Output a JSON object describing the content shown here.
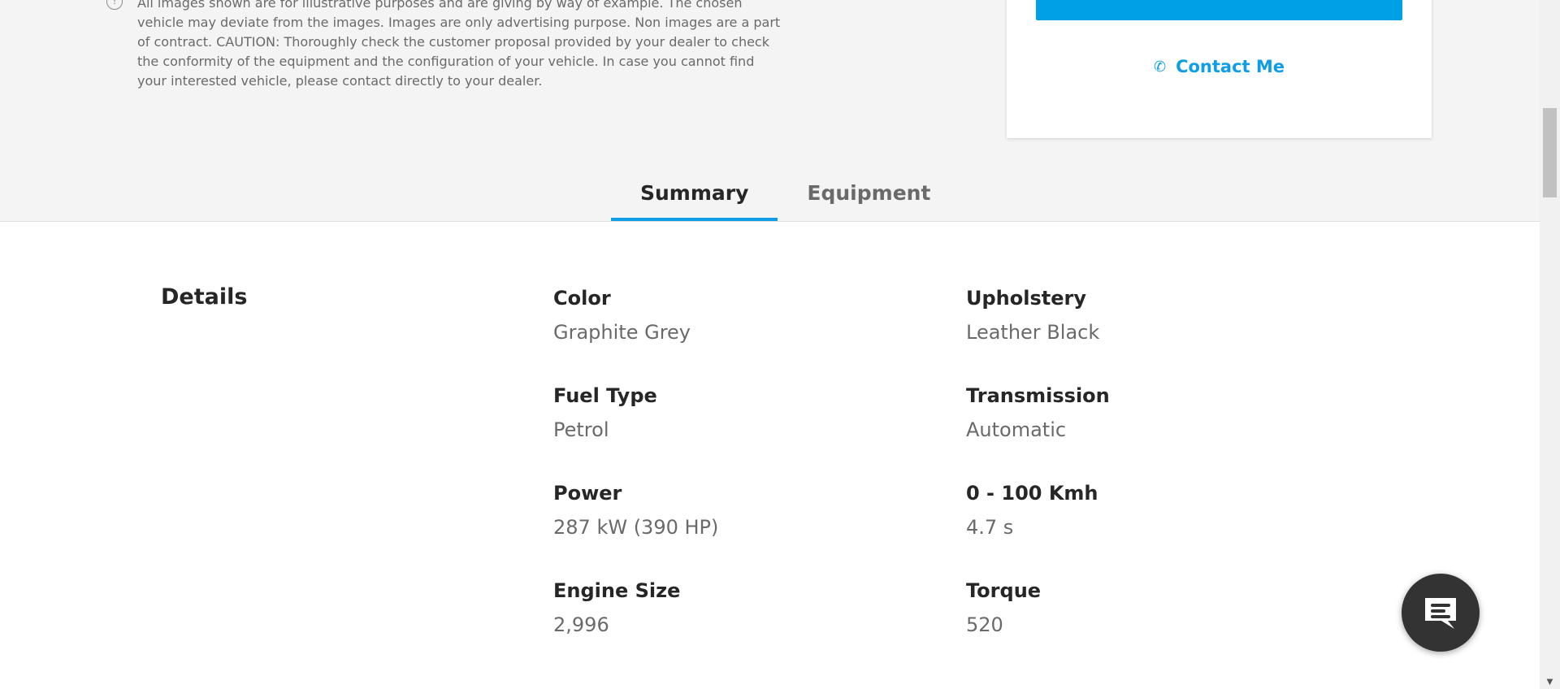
{
  "disclaimer": {
    "icon": "info-icon",
    "lines": [
      "All images shown are for illustrative purposes and are giving by way of example. The chosen",
      "vehicle may deviate from the images. Images are only advertising purpose. Non images are a part",
      "of contract. CAUTION: Thoroughly check the customer proposal provided by your dealer to check",
      "the conformity of the equipment and the configuration of your vehicle. In case you cannot find",
      "your interested vehicle, please contact directly to your dealer."
    ]
  },
  "card": {
    "contact_label": "Contact Me",
    "accent": "#0f9ee6"
  },
  "tabs": [
    {
      "label": "Summary",
      "active": true
    },
    {
      "label": "Equipment",
      "active": false
    }
  ],
  "details": {
    "title": "Details",
    "specs": [
      {
        "label": "Color",
        "value": "Graphite Grey"
      },
      {
        "label": "Upholstery",
        "value": "Leather Black"
      },
      {
        "label": "Fuel Type",
        "value": "Petrol"
      },
      {
        "label": "Transmission",
        "value": "Automatic"
      },
      {
        "label": "Power",
        "value": "287 kW (390 HP)"
      },
      {
        "label": "0 - 100 Kmh",
        "value": "4.7 s"
      },
      {
        "label": "Engine Size",
        "value": "2,996"
      },
      {
        "label": "Torque",
        "value": "520"
      }
    ]
  },
  "chat": {
    "icon": "chat-icon"
  }
}
